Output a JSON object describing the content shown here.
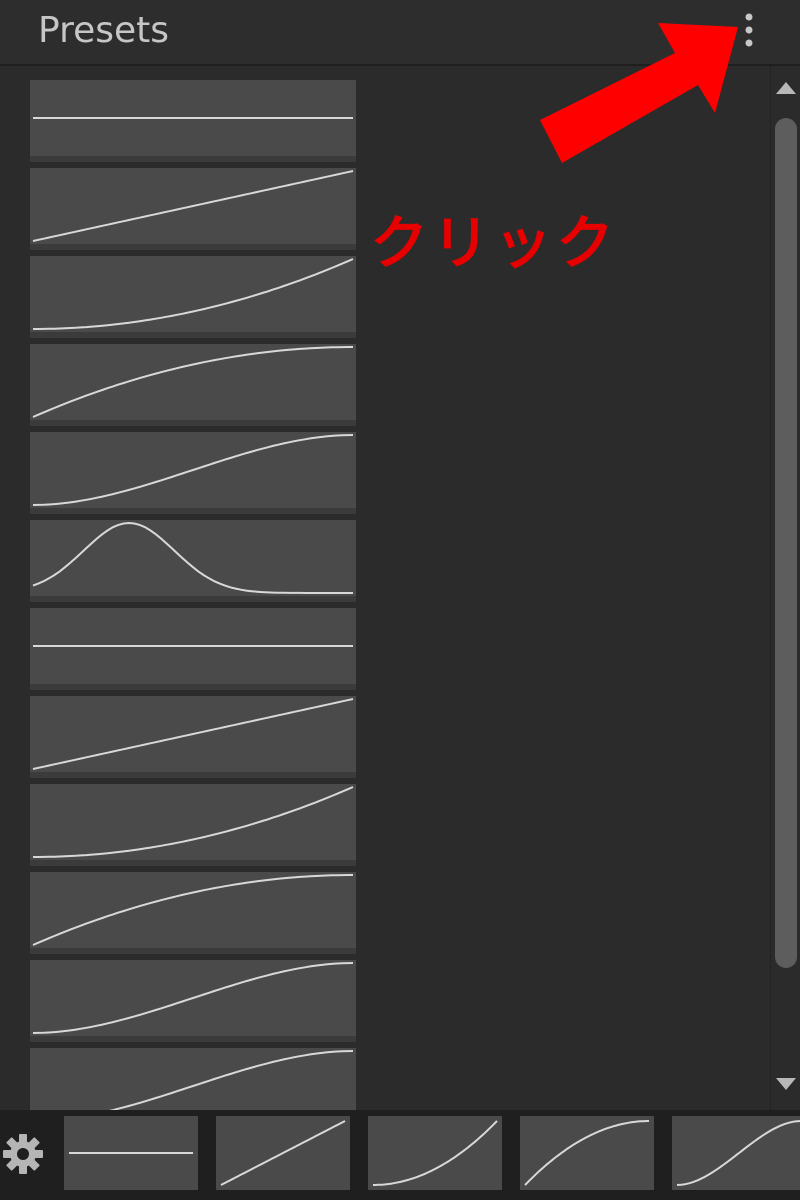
{
  "panel": {
    "title": "Presets",
    "menu_icon": "vertical-ellipsis-icon"
  },
  "presets": [
    {
      "curve": "flat"
    },
    {
      "curve": "linear"
    },
    {
      "curve": "ease-in"
    },
    {
      "curve": "ease-out"
    },
    {
      "curve": "ease-in-out"
    },
    {
      "curve": "bell"
    },
    {
      "curve": "flat"
    },
    {
      "curve": "linear"
    },
    {
      "curve": "ease-in"
    },
    {
      "curve": "ease-out"
    },
    {
      "curve": "ease-in-out"
    },
    {
      "curve": "ease-in-out"
    }
  ],
  "quick_presets": [
    {
      "curve": "flat"
    },
    {
      "curve": "linear"
    },
    {
      "curve": "ease-in"
    },
    {
      "curve": "ease-out"
    },
    {
      "curve": "ease-in-out"
    }
  ],
  "settings_icon": "gear-icon",
  "annotation": {
    "text": "クリック",
    "color": "#e60000"
  },
  "colors": {
    "panel_bg": "#2b2b2b",
    "tile_bg": "#4a4a4a",
    "curve": "#d8d8d8",
    "title": "#c6c6c6"
  }
}
